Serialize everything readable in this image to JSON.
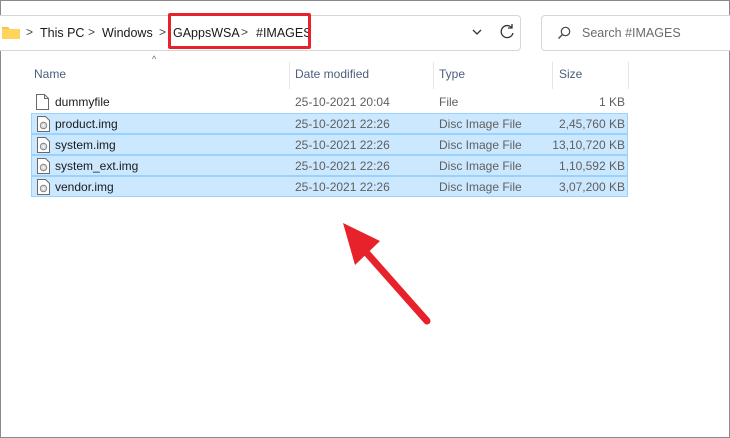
{
  "breadcrumb": {
    "items": [
      "This PC",
      "Windows",
      "GAppsWSA",
      "#IMAGES"
    ],
    "separator": ">"
  },
  "search": {
    "placeholder": "Search #IMAGES"
  },
  "columns": {
    "name": "Name",
    "date": "Date modified",
    "type": "Type",
    "size": "Size"
  },
  "files": [
    {
      "name": "dummyfile",
      "date": "25-10-2021 20:04",
      "type": "File",
      "size": "1 KB",
      "selected": false
    },
    {
      "name": "product.img",
      "date": "25-10-2021 22:26",
      "type": "Disc Image File",
      "size": "2,45,760 KB",
      "selected": true
    },
    {
      "name": "system.img",
      "date": "25-10-2021 22:26",
      "type": "Disc Image File",
      "size": "13,10,720 KB",
      "selected": true
    },
    {
      "name": "system_ext.img",
      "date": "25-10-2021 22:26",
      "type": "Disc Image File",
      "size": "1,10,592 KB",
      "selected": true
    },
    {
      "name": "vendor.img",
      "date": "25-10-2021 22:26",
      "type": "Disc Image File",
      "size": "3,07,200 KB",
      "selected": true
    }
  ],
  "colors": {
    "highlight": "#e8222a",
    "selection": "#cce8ff",
    "selection_border": "#99d1ff",
    "folder": "#f4c542"
  },
  "icons": {
    "folder": "folder-icon",
    "file": "file-icon",
    "disc_image": "disc-image-icon",
    "search": "search-icon",
    "refresh": "refresh-icon",
    "dropdown": "chevron-down-icon"
  }
}
